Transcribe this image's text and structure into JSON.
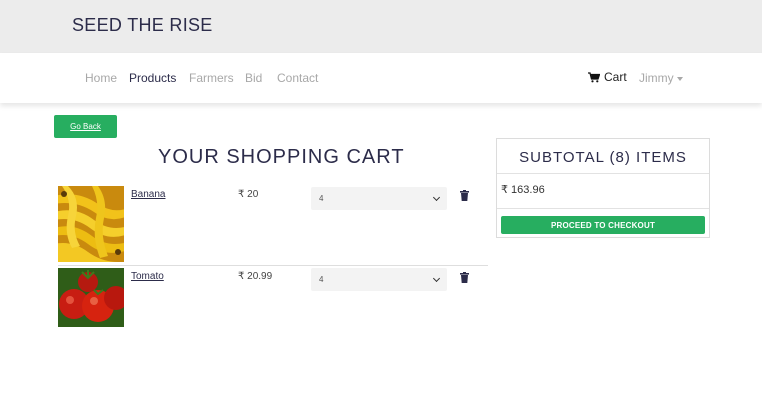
{
  "brand": "SEED THE RISE",
  "nav": {
    "home": "Home",
    "products": "Products",
    "farmers": "Farmers",
    "bid": "Bid",
    "contact": "Contact",
    "cart": "Cart",
    "user": "Jimmy"
  },
  "go_back": "Go Back",
  "cart_title": "YOUR SHOPPING CART",
  "items": [
    {
      "name": "Banana",
      "price": "₹ 20",
      "qty": "4",
      "image": "banana-image"
    },
    {
      "name": "Tomato",
      "price": "₹ 20.99",
      "qty": "4",
      "image": "tomato-image"
    }
  ],
  "summary": {
    "title": "SUBTOTAL (8) ITEMS",
    "amount": "₹ 163.96",
    "checkout": "PROCEED TO CHECKOUT"
  },
  "colors": {
    "accent_green": "#27ae60",
    "header_bg": "#ececec",
    "text_dark": "#2c2c4a"
  }
}
